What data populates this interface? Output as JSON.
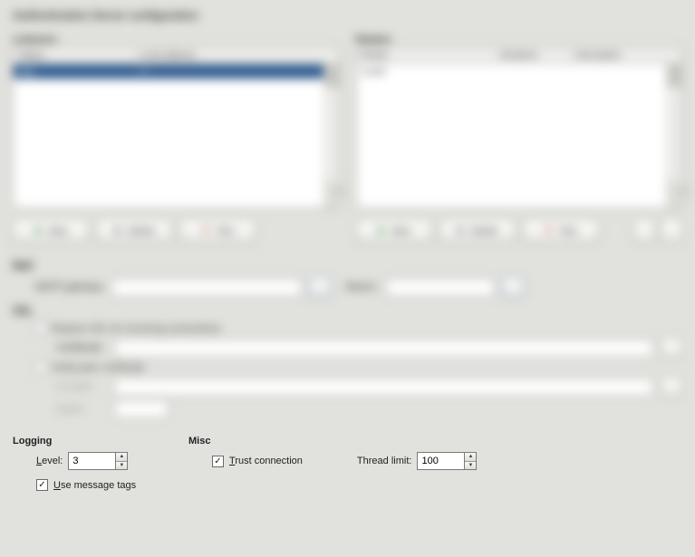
{
  "title": "Authentication Server configuration",
  "listeners": {
    "header": "Listeners",
    "columns": [
      "Status",
      "Local address"
    ],
    "rows": [
      {
        "status": "any",
        "addr": "*:*",
        "selected": true
      }
    ],
    "buttons": {
      "new": "New",
      "delete": "Delete",
      "test": "Test"
    }
  },
  "realms": {
    "header": "Realms",
    "columns": [
      "Realm",
      "Iterations",
      "Description"
    ],
    "rows": [
      {
        "realm": "Local",
        "iter": "",
        "desc": ""
      }
    ],
    "buttons": {
      "new": "New",
      "delete": "Delete",
      "test": "Test"
    }
  },
  "mail": {
    "header": "Mail",
    "gateway_label": "SMTP gateway:",
    "gateway_value": "",
    "return_label": "Return:",
    "return_value": ""
  },
  "ssl": {
    "header": "SSL",
    "require_label": "Require SSL for incoming connections",
    "cert_label": "Certificate:",
    "cert_value": "",
    "verify_label": "Verify peer certificate",
    "cafile_label": "CA path:",
    "cafile_value": "",
    "depth_label": "Depth:",
    "depth_value": ""
  },
  "logging": {
    "header": "Logging",
    "level_label": "Level:",
    "level_value": "3",
    "usetags_label": "Use message tags",
    "usetags_checked": true
  },
  "misc": {
    "header": "Misc",
    "trust_label": "Trust connection",
    "trust_checked": true,
    "thread_label": "Thread limit:",
    "thread_value": "100"
  }
}
